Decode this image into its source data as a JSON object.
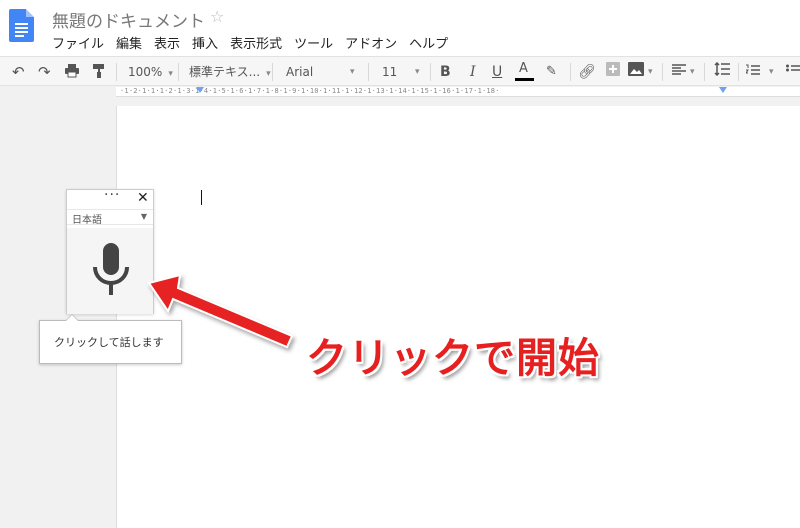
{
  "header": {
    "title": "無題のドキュメント",
    "menu": [
      "ファイル",
      "編集",
      "表示",
      "挿入",
      "表示形式",
      "ツール",
      "アドオン",
      "ヘルプ"
    ]
  },
  "toolbar": {
    "zoom": "100%",
    "style": "標準テキス...",
    "font": "Arial",
    "font_size": "11",
    "bold": "B",
    "italic": "I",
    "underline": "U",
    "text_color": "A"
  },
  "ruler": {
    "ticks": "·1·2·1·1·1·2·1·3·1·4·1·5·1·6·1·7·1·8·1·9·1·10·1·11·1·12·1·13·1·14·1·15·1·16·1·17·1·18·"
  },
  "voice": {
    "language": "日本語",
    "tooltip": "クリックして話します",
    "mic_color": "#444444"
  },
  "annotation": {
    "text": "クリックで開始",
    "color": "#e62020"
  }
}
